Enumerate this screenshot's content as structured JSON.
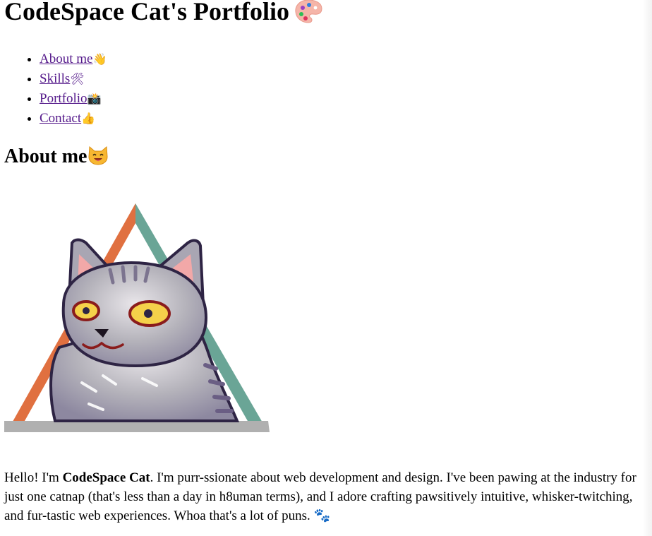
{
  "header": {
    "title": "CodeSpace Cat's Portfolio",
    "title_icon": "artist-palette-icon"
  },
  "nav": {
    "items": [
      {
        "label": "About me",
        "icon": "waving-hand-icon",
        "emoji": "👋"
      },
      {
        "label": "Skills",
        "icon": "hammer-and-wrench-icon",
        "emoji": "🛠"
      },
      {
        "label": "Portfolio",
        "icon": "camera-icon",
        "emoji": "📸"
      },
      {
        "label": "Contact",
        "icon": "thumbs-up-icon",
        "emoji": "👍"
      }
    ],
    "link_color": "#551a8b"
  },
  "about": {
    "heading": "About me",
    "heading_icon": "cat-face-icon",
    "heading_emoji": "😺",
    "image": "codespace-cat-triangle-logo",
    "intro_prefix": "Hello! I'm ",
    "name": "CodeSpace Cat",
    "intro_suffix": ". I'm purr-ssionate about web development and design. I've been pawing at the industry for just one catnap (that's less than a day in h8uman terms), and I adore crafting pawsitively intuitive, whisker-twitching, and fur-tastic web experiences. Whoa that's a lot of puns. ",
    "end_icon": "paw-prints-icon",
    "end_emoji": "🐾"
  },
  "colors": {
    "triangle_left": "#e07040",
    "triangle_right": "#6aa596",
    "triangle_base": "#b0b0b0",
    "cat_fur": "#b8b8bf",
    "cat_outline": "#2e2444",
    "cat_eye": "#f5d14a",
    "cat_ear_inner": "#f2a8a8"
  }
}
